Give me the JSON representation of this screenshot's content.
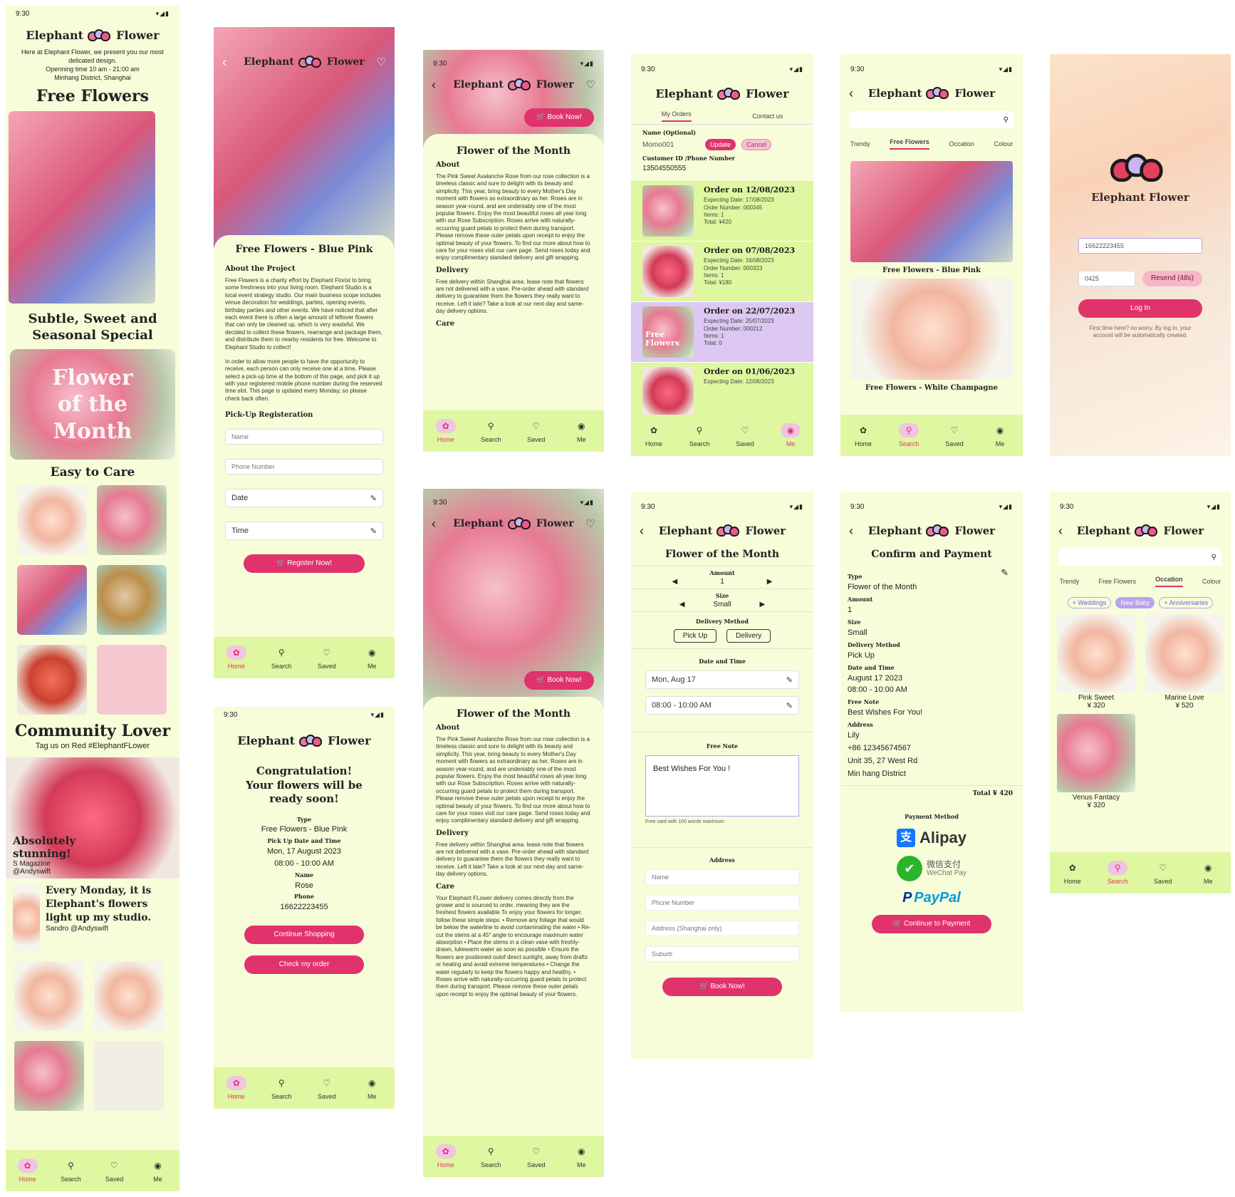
{
  "status": {
    "time": "9:30"
  },
  "brand": {
    "left": "Elephant",
    "right": "Flower",
    "full": "Elephant Flower"
  },
  "nav": {
    "home": "Home",
    "search": "Search",
    "saved": "Saved",
    "me": "Me"
  },
  "s1": {
    "intro": "Here at Elephant Flower, we present you our most delicated design.",
    "hours": "Openning time 10 am - 21:00 am",
    "address": "Minhang District, Shanghai",
    "free": "Free Flowers",
    "subtle": "Subtle, Sweet and Seasonal Special",
    "fotm": "Flower of the Month",
    "easy": "Easy to Care",
    "community": "Community Lover",
    "tag": "Tag us on Red #ElephantFLower",
    "quote1": "Absolutely stunning!",
    "quote1by": "S Magazine",
    "quote1handle": "@Andyswift",
    "quote2": "Every Monday, it is Elephant's flowers light up my studio.",
    "quote2by": "Sandro @Andyswift"
  },
  "s2": {
    "title": "Free Flowers - Blue Pink",
    "about": "About the Project",
    "p1": "Free Flowers is a charity effort by Elephant Florist to bring some freshness into your living room. Elephant Studio is a local event strategy studio. Our main business scope includes venue decoration for weddings, parties, opening events, birthday parties and other events. We have noticed that after each event there is often a large amount of leftover flowers that can only be cleaned up, which is very wasteful. We decided to collect these flowers, rearrange and package them, and distribute them to nearby residents for free. Welcome to Elephant Studio to collect!",
    "p2": "In order to allow more people to have the opportunity to receive, each person can only receive one at a time. Please select a pick-up time at the bottom of this page, and pick it up with your registered mobile phone number during the reserved time slot. This page is updated every Monday, so please check back often.",
    "reg": "Pick-Up Registeration",
    "name": "Name",
    "phone": "Phone Number",
    "date": "Date",
    "time": "Time",
    "btn": "Register Now!"
  },
  "s3": {
    "book": "Book Now!",
    "title": "Flower of the Month",
    "about": "About",
    "p1": "The Pink Sweet Avalanche Rose from our rose collection is a timeless classic and sure to delight with its beauty and simplicity. This year, bring beauty to every Mother's Day moment with flowers as extraordinary as her. Roses are in season year-round, and are undeniably one of the most popular flowers. Enjoy the most beautiful roses all year long with our Rose Subscription. Roses arrive with naturally-occurring guard petals to protect them during transport. Please remove these outer petals upon receipt to enjoy the optimal beauty of your flowers. To find our more about how to care for your roses visit our care page. Send roses today and enjoy complimentary standard delivery and gift wrapping.",
    "delivery": "Delivery",
    "p2": "Free delivery within Shanghai area. lease note that flowers are not delivered with a vase. Pre-order ahead with standard delivery to guarantee them the flowers they really want to receive. Left it late? Take a look at our next-day and same-day delivery options.",
    "care": "Care",
    "p3": "Your Elephant FLower delivery comes directly from the grower and is sourced to order, meaning they are the freshest flowers available.To enjoy your flowers for longer, follow these simple steps: • Remove any foliage that would be below the waterline to avoid contaminating the water • Re-cut the stems at a 45° angle to encourage maximum water absorption • Place the stems in a clean vase with freshly-drawn, lukewarm water as soon as possible • Ensure the flowers are positioned outof direct sunlight, away from drafts or heating and avoid extreme temperatures • Change the water regularly to keep the flowers happy and healthy. • Roses arrive with naturally-occurring guard petals to protect them during transport. Please remove these outer petals upon receipt to enjoy the optimal beauty of your flowers."
  },
  "s4": {
    "tab1": "My Orders",
    "tab2": "Contact us",
    "namelbl": "Name (Optional)",
    "nameval": "Momo001",
    "update": "Update",
    "cancel": "Cancel",
    "cidlbl": "Customer ID /Phone Number",
    "cidval": "13504550555",
    "orders": [
      {
        "title": "Order on 12/08/2023",
        "exp": "Expecting Date: 17/08/2023",
        "num": "Order Number: 000345",
        "items": "Items: 1",
        "total": "Total: ¥420",
        "bg": "#dff7a0"
      },
      {
        "title": "Order on 07/08/2023",
        "exp": "Expecting Date: 16/08/2023",
        "num": "Order Number: 000323",
        "items": "Items: 1",
        "total": "Total: ¥180",
        "bg": "#dff7a0"
      },
      {
        "title": "Order on 22/07/2023",
        "exp": "Expecting Date: 25/07/2023",
        "num": "Order Number: 000212",
        "items": "Items: 1",
        "total": "Total: 0",
        "bg": "#dcc8f2",
        "thumb": "Free Flowers"
      },
      {
        "title": "Order on 01/06/2023",
        "exp": "Expecting Date: 12/06/2023",
        "num": "",
        "items": "",
        "total": "",
        "bg": "#dff7a0"
      }
    ]
  },
  "s5": {
    "tabs": [
      "Trendy",
      "Free Flowers",
      "Occation",
      "Colour"
    ],
    "c1": "Free Flowers - Blue Pink",
    "c2": "Free Flowers - White Champagne"
  },
  "s6": {
    "phone": "16622223455",
    "code": "0425",
    "resend": "Resend (48s)",
    "login": "Log In",
    "note": "First time here? no worry. By log in, your account will be automatically created."
  },
  "s7": {
    "title": "Congratulation! Your flowers will be ready soon!",
    "type": "Type",
    "typeval": "Free Flowers - Blue Pink",
    "pick": "Pick Up Date and Time",
    "date": "Mon, 17 August 2023",
    "time": "08:00 - 10:00 AM",
    "name": "Name",
    "nameval": "Rose",
    "phone": "Phone",
    "phoneval": "16622223455",
    "b1": "Continue Shopping",
    "b2": "Check my order"
  },
  "s9": {
    "title": "Flower of the Month",
    "amount": "Amount",
    "amountval": "1",
    "size": "Size",
    "sizeval": "Small",
    "dm": "Delivery Method",
    "pickup": "Pick Up",
    "delivery": "Delivery",
    "dt": "Date and Time",
    "date": "Mon, Aug 17",
    "time": "08:00 - 10:00 AM",
    "fn": "Free Note",
    "note": "Best Wishes For You !",
    "cardnote": "Free card with 100 words maximum",
    "addr": "Address",
    "f1": "Name",
    "f2": "Phcne Number",
    "f3": "Address (Shanghai only)",
    "f4": "Suburb",
    "btn": "Book Now!"
  },
  "s10": {
    "title": "Confirm and Payment",
    "rows": [
      [
        "Type",
        "Flower of the Month"
      ],
      [
        "Amount",
        "1"
      ],
      [
        "Size",
        "Small"
      ],
      [
        "Delivery Method",
        "Pick Up"
      ],
      [
        "Date and Time",
        "August 17 2023"
      ]
    ],
    "time": "08:00 - 10:00 AM",
    "fn": "Free Note",
    "fnval": "Best Wishes For You!",
    "addr": "Address",
    "a1": "Lily",
    "a2": "+86 12345674567",
    "a3": "Unit 35, 27 West Rd",
    "a4": "Min hang District",
    "total": "Total ¥ 420",
    "pm": "Payment Method",
    "alipay": "Alipay",
    "wechat1": "微信支付",
    "wechat2": "WeChat Pay",
    "paypal": "PayPal",
    "btn": "Continue to Payment"
  },
  "s11": {
    "tabs": [
      "Trendy",
      "Free Flowers",
      "Occation",
      "Colour"
    ],
    "chips": [
      "+ Weddings",
      "New Baby",
      "+ Anniversaries"
    ],
    "items": [
      {
        "name": "Pink Sweet",
        "price": "¥ 320"
      },
      {
        "name": "Marine Love",
        "price": "¥ 520"
      },
      {
        "name": "Venus Fantacy",
        "price": "¥ 320"
      }
    ]
  }
}
